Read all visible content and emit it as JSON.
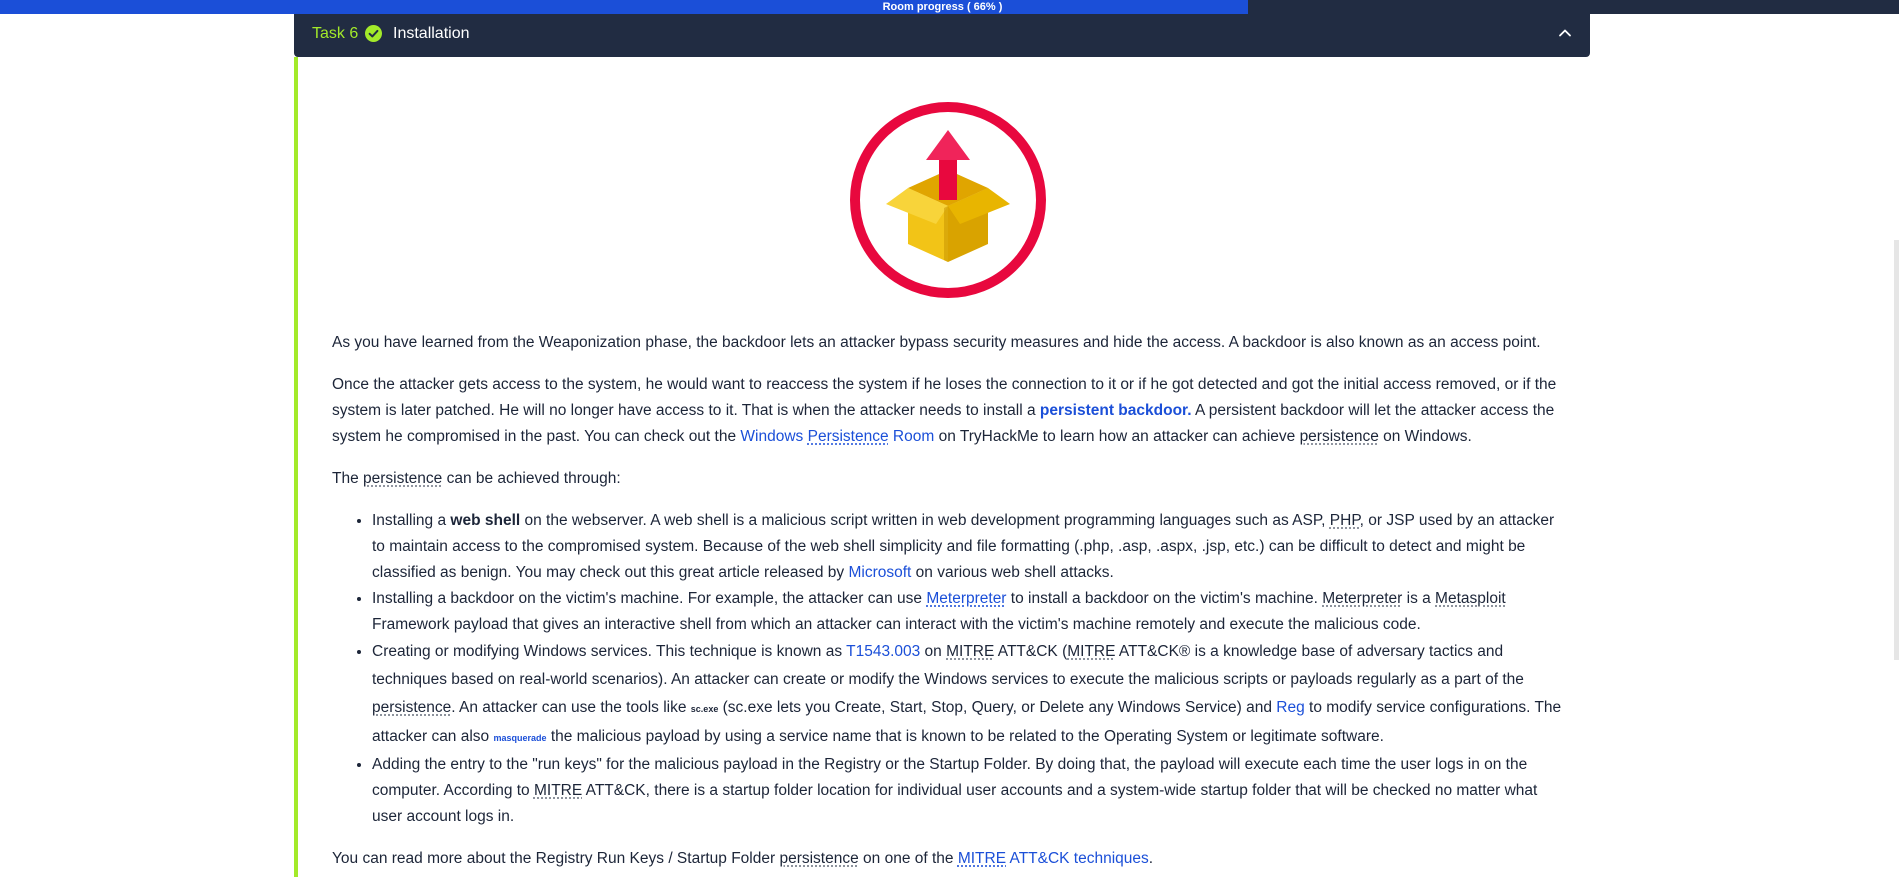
{
  "progress": {
    "label": "Room progress ( 66% )",
    "value": 0.66,
    "fill_color": "#1b4fd8",
    "track_color": "#212c42"
  },
  "task": {
    "number": "Task 6",
    "title": "Installation",
    "status_icon": "check-circle-icon",
    "toggle_icon": "chevron-up-icon",
    "accent_color": "#a3ea2a"
  },
  "hero": {
    "icon": "package-upload-icon"
  },
  "content": {
    "p1": "As you have learned from the Weaponization phase, the backdoor lets an attacker bypass security measures and hide the access. A backdoor is also known as an access point.",
    "p2": {
      "t1": "Once the attacker gets access to the system, he would want to reaccess the system if he loses the connection to it or if he got detected and got the initial access removed, or if the system is later patched. He will no longer have access to it. That is when the attacker needs to install a ",
      "strong": "persistent backdoor.",
      "t2": " A persistent backdoor will let the attacker access the system he compromised in the past. You can check out the ",
      "link_windows": "Windows",
      "link_persistence": "Persistence",
      "link_room": "Room",
      "t3": " on TryHackMe to learn how an attacker can achieve ",
      "abbr_persistence": "persistence",
      "t4": " on Windows."
    },
    "p3": {
      "t1": "The ",
      "abbr": "persistence",
      "t2": " can be achieved through:"
    },
    "li1": {
      "t1": "Installing a ",
      "bold": "web shell",
      "t2": " on the webserver. A web shell is a malicious script written in web development programming languages such as ASP, ",
      "abbr_php": "PHP",
      "t3": ", or JSP used by an attacker to maintain access to the compromised system. Because of the web shell simplicity and file formatting (.php, .asp, .aspx, .jsp, etc.) can be difficult to detect and might be classified as benign. You may check out this great article released by ",
      "link": "Microsoft",
      "t4": " on various web shell attacks."
    },
    "li2": {
      "t1": "Installing a backdoor on the victim's machine. For example, the attacker can use ",
      "link": "Meterpreter",
      "t2": " to install a backdoor on the victim's machine. ",
      "abbr_meterpreter": "Meterpreter",
      "t3": " is a ",
      "abbr_metasploit": "Metasploit",
      "t4": " Framework payload that gives an interactive shell from which an attacker can interact with the victim's machine remotely and execute the malicious code."
    },
    "li3": {
      "t1": "Creating or modifying Windows services. This technique is known as ",
      "link_t": "T1543.003",
      "t2": " on ",
      "abbr_mitre1": "MITRE",
      "t3": " ATT&CK (",
      "abbr_mitre2": "MITRE",
      "t4": " ATT&CK® is a knowledge base of adversary tactics and techniques based on real-world scenarios). An attacker can create or modify the Windows services to execute the malicious scripts or payloads regularly as a part of the ",
      "abbr_persistence": "persistence",
      "t5": ". An attacker can use the tools like ",
      "tiny": "sc.exe",
      "t6": " (sc.exe lets you Create, Start, Stop, Query, or Delete any Windows Service) and ",
      "link_reg": "Reg",
      "t7": " to modify service configurations. The attacker can also ",
      "tiny_link": "masquerade",
      "t8": " the malicious payload by using a service name that is known to be related to the Operating System or legitimate software."
    },
    "li4": {
      "t1": "Adding the entry to the \"run keys\" for the malicious payload in the Registry or the Startup Folder. By doing that, the payload will execute each time the user logs in on the computer. According to ",
      "abbr_mitre": "MITRE",
      "t2": " ATT&CK, there is a startup folder location for individual user accounts and a system-wide startup folder that will be checked no matter what user account logs in."
    },
    "p4": {
      "t1": "You can read more about the Registry Run Keys / Startup Folder ",
      "abbr": "persistence",
      "t2": " on one of the ",
      "link_mitre": "MITRE",
      "link_rest": "ATT&CK techniques",
      "t3": "."
    }
  }
}
